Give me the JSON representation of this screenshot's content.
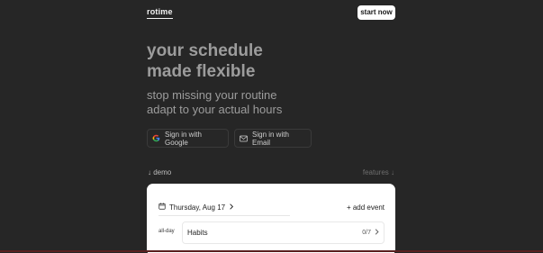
{
  "header": {
    "logo": "rotime",
    "start_button": "start now"
  },
  "hero": {
    "headline_line1": "your schedule",
    "headline_line2": "made flexible",
    "sub_line1": "stop missing your routine",
    "sub_line2": "adapt to your actual hours"
  },
  "auth": {
    "google_label": "Sign in with Google",
    "email_label": "Sign in with Email",
    "google_icon": "google-icon",
    "email_icon": "mail-icon"
  },
  "links": {
    "demo": "↓ demo",
    "features": "features ↓"
  },
  "demo_card": {
    "date_label": "Thursday, Aug 17",
    "add_event": "+ add event",
    "allday_label": "all-day",
    "habit_title": "Habits",
    "habit_count": "0/7"
  },
  "colors": {
    "background": "#262626",
    "card": "#ffffff",
    "headline": "#9c9c9c"
  }
}
